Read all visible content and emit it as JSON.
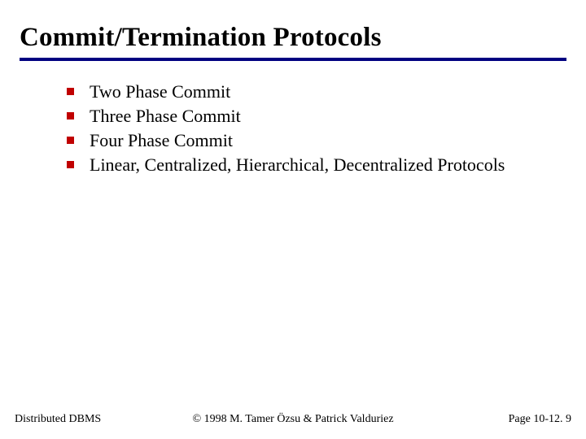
{
  "title": "Commit/Termination Protocols",
  "bullets": [
    "Two Phase Commit",
    "Three Phase Commit",
    "Four Phase Commit",
    "Linear, Centralized, Hierarchical, Decentralized Protocols"
  ],
  "footer": {
    "left": "Distributed DBMS",
    "center": "© 1998 M. Tamer Özsu & Patrick Valduriez",
    "right": "Page 10-12. 9"
  },
  "colors": {
    "rule": "#000080",
    "bullet_square": "#c00000"
  }
}
